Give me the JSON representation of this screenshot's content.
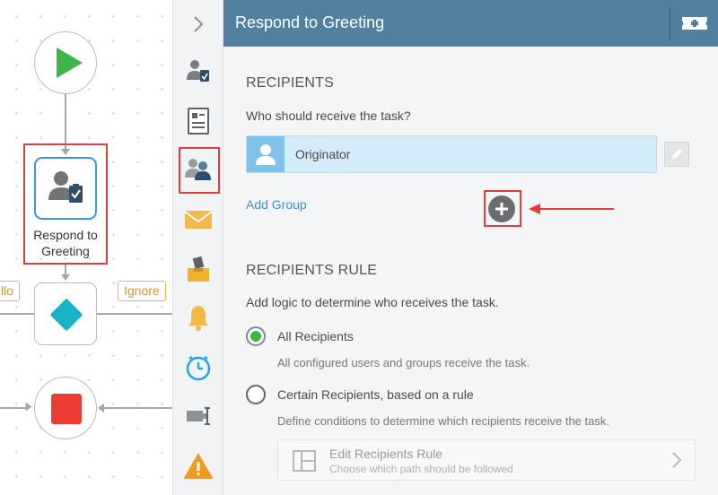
{
  "canvas": {
    "task_label": "Respond to Greeting",
    "lane_tag_left": "llo",
    "lane_tag_right": "Ignore"
  },
  "toolbar": {
    "items": [
      {
        "name": "collapse-chevron-icon"
      },
      {
        "name": "user-task-icon"
      },
      {
        "name": "form-icon"
      },
      {
        "name": "recipients-icon",
        "selected": true
      },
      {
        "name": "email-icon"
      },
      {
        "name": "inbox-icon"
      },
      {
        "name": "notification-bell-icon"
      },
      {
        "name": "timer-icon"
      },
      {
        "name": "field-icon"
      },
      {
        "name": "warning-icon"
      }
    ]
  },
  "panel": {
    "title": "Respond to Greeting",
    "recipients": {
      "heading": "RECIPIENTS",
      "question": "Who should receive the task?",
      "items": [
        {
          "name": "Originator"
        }
      ],
      "add_group": "Add Group"
    },
    "recipients_rule": {
      "heading": "RECIPIENTS RULE",
      "description": "Add logic to determine who receives the task.",
      "options": [
        {
          "label": "All Recipients",
          "description": "All configured users and groups receive the task.",
          "checked": true
        },
        {
          "label": "Certain Recipients, based on a rule",
          "description": "Define conditions to determine which recipients receive the task.",
          "checked": false
        }
      ],
      "edit_rule": {
        "title": "Edit Recipients Rule",
        "subtitle": "Choose which path should be followed"
      }
    }
  },
  "colors": {
    "header": "#52819f",
    "accent_link": "#3a92cf",
    "highlight_red": "#e53b3b",
    "start_green": "#3cb54a",
    "gateway_teal": "#17b2c8",
    "stop_red": "#ee3b33",
    "tag_orange": "#d7952a"
  }
}
